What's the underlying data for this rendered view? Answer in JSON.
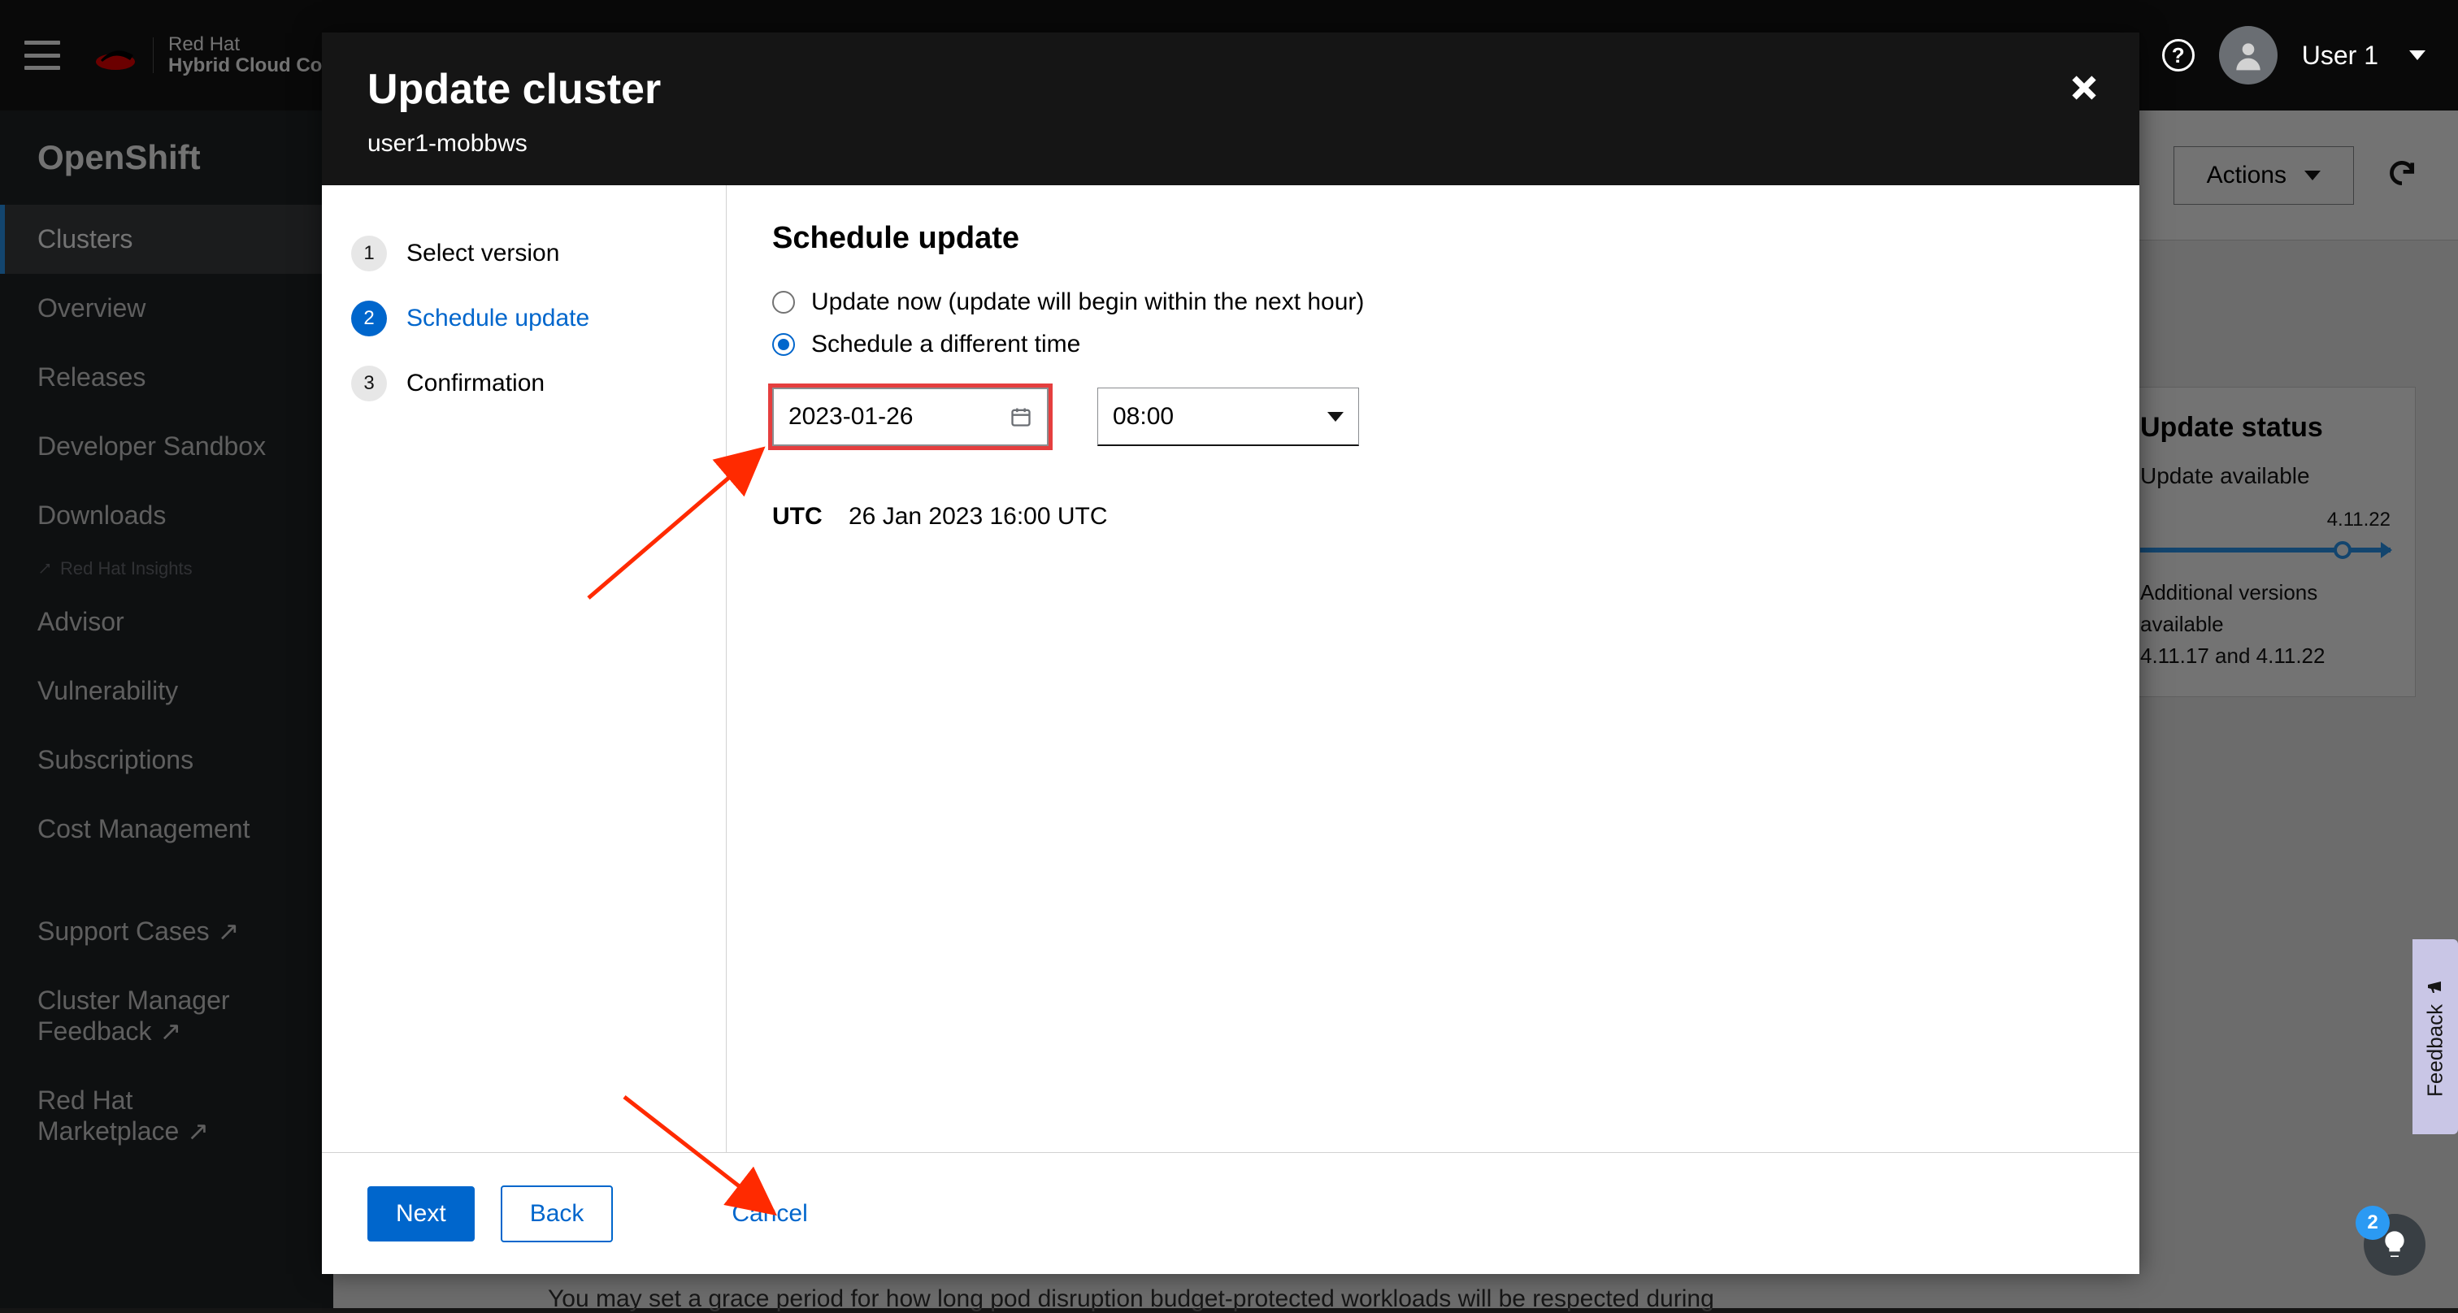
{
  "masthead": {
    "brand_line1": "Red Hat",
    "brand_line2": "Hybrid Cloud Console",
    "user_label": "User 1",
    "help_notification_count": "2"
  },
  "sidebar": {
    "section": "OpenShift",
    "items": [
      {
        "label": "Clusters",
        "active": true
      },
      {
        "label": "Overview"
      },
      {
        "label": "Releases"
      },
      {
        "label": "Developer Sandbox"
      },
      {
        "label": "Downloads"
      }
    ],
    "insights_label": "Red Hat Insights",
    "insights_items": [
      {
        "label": "Advisor"
      },
      {
        "label": "Vulnerability"
      },
      {
        "label": "Subscriptions"
      },
      {
        "label": "Cost Management"
      }
    ],
    "footer_items": [
      {
        "label": "Support Cases",
        "external": true
      },
      {
        "label": "Cluster Manager Feedback",
        "external": true
      },
      {
        "label": "Red Hat Marketplace",
        "external": true
      }
    ]
  },
  "page": {
    "actions_label": "Actions",
    "update_status_title": "Update status",
    "update_status_value": "Update available",
    "version_target": "4.11.22",
    "avail_line1": "Additional versions available",
    "avail_line2": "4.11.17 and 4.11.22",
    "grace_text": "You may set a grace period for how long pod disruption budget-protected workloads will be respected during"
  },
  "modal": {
    "title": "Update cluster",
    "subtitle": "user1-mobbws",
    "steps": [
      {
        "num": "1",
        "label": "Select version"
      },
      {
        "num": "2",
        "label": "Schedule update"
      },
      {
        "num": "3",
        "label": "Confirmation"
      }
    ],
    "content_title": "Schedule update",
    "radio_now": "Update now (update will begin within the next hour)",
    "radio_later": "Schedule a different time",
    "date_value": "2023-01-26",
    "time_value": "08:00",
    "utc_label": "UTC",
    "utc_value": "26 Jan 2023 16:00 UTC",
    "next": "Next",
    "back": "Back",
    "cancel": "Cancel"
  },
  "feedback_tab": "Feedback"
}
